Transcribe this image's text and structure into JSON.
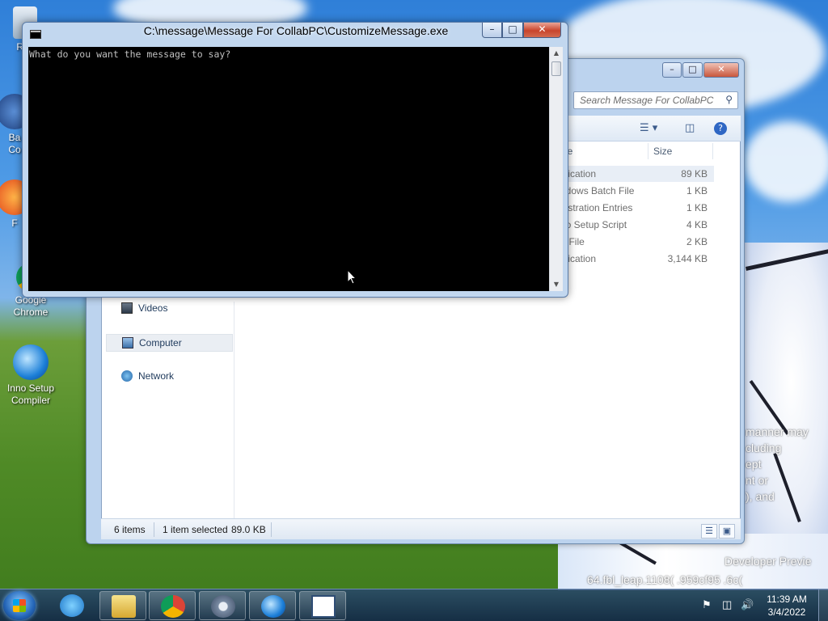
{
  "desktop": {
    "icons": [
      {
        "label": "Rec"
      },
      {
        "label": "Ba\nCo"
      },
      {
        "label": "F"
      },
      {
        "label": "Google\nChrome"
      },
      {
        "label": "Inno Setup\nCompiler"
      }
    ],
    "watermark": {
      "lines": [
        "manner may",
        "cluding",
        "ept",
        "nt or",
        "), and"
      ],
      "build_title": "Developer Previe",
      "build_string": "64.fbl_leap.1108( .959cf95 .6c("
    }
  },
  "console": {
    "title": "C:\\message\\Message For CollabPC\\CustomizeMessage.exe",
    "output": "What do you want the message to say?",
    "buttons": {
      "minimize": "–",
      "maximize": "□",
      "close": "✕"
    }
  },
  "explorer": {
    "buttons": {
      "minimize": "–",
      "maximize": "□",
      "close": "✕"
    },
    "search_placeholder": "Search Message For CollabPC",
    "columns": {
      "type": "pe",
      "size": "Size"
    },
    "files": [
      {
        "type": "plication",
        "size": "89 KB",
        "selected": true
      },
      {
        "type": "ndows Batch File",
        "size": "1 KB",
        "selected": false
      },
      {
        "type": "gistration Entries",
        "size": "1 KB",
        "selected": false
      },
      {
        "type": "no Setup Script",
        "size": "4 KB",
        "selected": false
      },
      {
        "type": "T File",
        "size": "2 KB",
        "selected": false
      },
      {
        "type": "plication",
        "size": "3,144 KB",
        "selected": false
      }
    ],
    "nav": [
      {
        "label": "Videos",
        "selected": false
      },
      {
        "label": "Computer",
        "selected": true
      },
      {
        "label": "Network",
        "selected": false
      }
    ],
    "status": {
      "items": "6 items",
      "selection": "1 item selected",
      "selection_size": "89.0 KB"
    }
  },
  "taskbar": {
    "apps": [
      {
        "name": "internet-explorer-icon",
        "running": false
      },
      {
        "name": "file-explorer-icon",
        "running": true
      },
      {
        "name": "chrome-icon",
        "running": true
      },
      {
        "name": "settings-gear-icon",
        "running": true
      },
      {
        "name": "inno-setup-icon",
        "running": true
      },
      {
        "name": "console-icon",
        "running": true
      }
    ],
    "clock": {
      "time": "11:39 AM",
      "date": "3/4/2022"
    }
  }
}
